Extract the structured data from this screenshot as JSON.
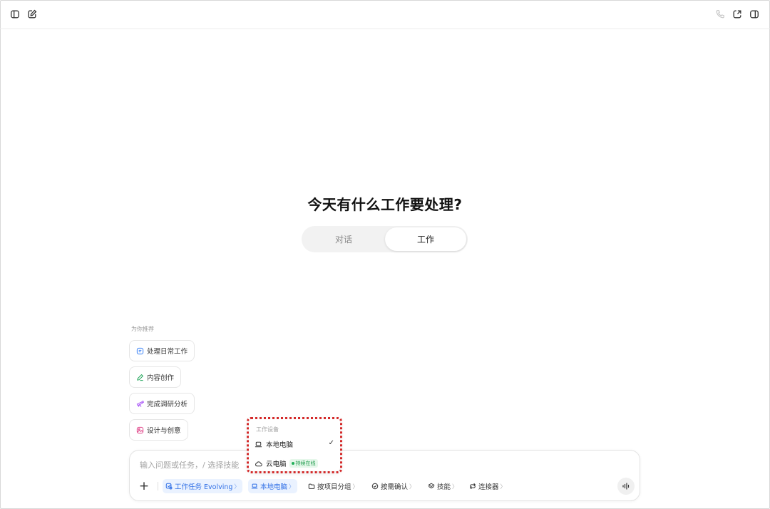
{
  "title": "今天有什么工作要处理?",
  "toggle": {
    "left": "对话",
    "right": "工作",
    "active": "工作"
  },
  "recommend": {
    "label": "为你推荐",
    "items": [
      {
        "label": "处理日常工作",
        "icon": "list-icon",
        "color": "#3b82f6"
      },
      {
        "label": "内容创作",
        "icon": "pen-icon",
        "color": "#22a55a"
      },
      {
        "label": "完成调研分析",
        "icon": "telescope-icon",
        "color": "#a855f7"
      },
      {
        "label": "设计与创意",
        "icon": "image-icon",
        "color": "#e0468a"
      }
    ]
  },
  "dropdown": {
    "header": "工作设备",
    "items": [
      {
        "label": "本地电脑",
        "icon": "laptop-icon",
        "checked": true
      },
      {
        "label": "云电脑",
        "icon": "cloud-icon",
        "badge": "持续在线"
      }
    ]
  },
  "input": {
    "placeholder": "输入问题或任务，/ 选择技能",
    "tools": [
      {
        "label": "工作任务 Evolving",
        "icon": "task-icon",
        "active": true
      },
      {
        "label": "本地电脑",
        "icon": "laptop-icon",
        "active": true
      },
      {
        "label": "按项目分组",
        "icon": "folder-icon"
      },
      {
        "label": "按需确认",
        "icon": "shield-check-icon"
      },
      {
        "label": "技能",
        "icon": "layers-icon"
      },
      {
        "label": "连接器",
        "icon": "link-icon"
      }
    ],
    "chevron": "〉"
  },
  "colors": {
    "accent": "#2f6fe6",
    "highlight": "#d42a2a",
    "online": "#22b05a"
  }
}
